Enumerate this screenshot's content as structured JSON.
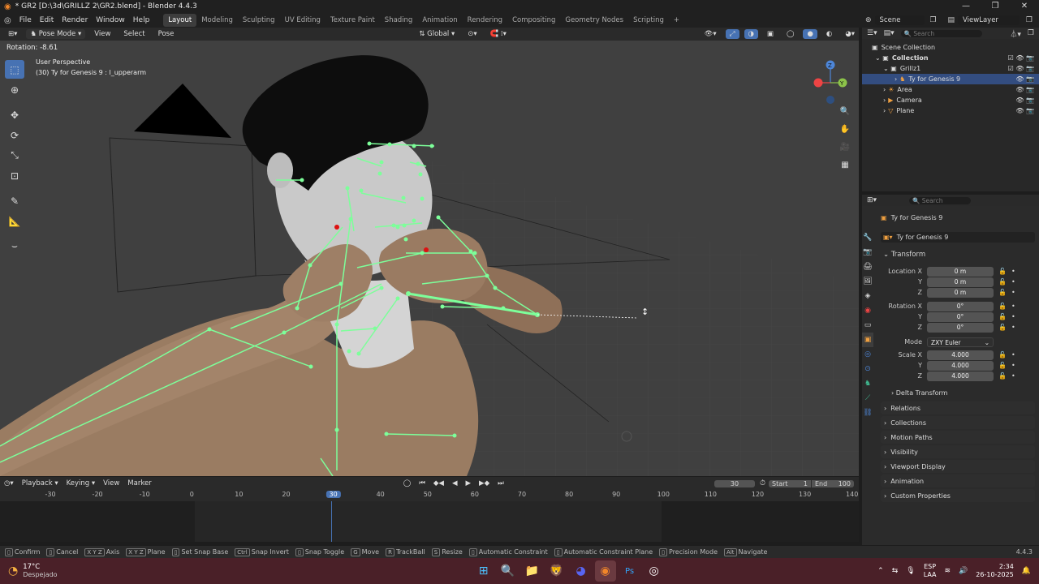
{
  "window": {
    "title": "* GR2 [D:\\3d\\GRILLZ 2\\GR2.blend] - Blender 4.4.3",
    "controls": [
      "—",
      "❐",
      "✕"
    ]
  },
  "menu": [
    "File",
    "Edit",
    "Render",
    "Window",
    "Help"
  ],
  "workspaces": [
    "Layout",
    "Modeling",
    "Sculpting",
    "UV Editing",
    "Texture Paint",
    "Shading",
    "Animation",
    "Rendering",
    "Compositing",
    "Geometry Nodes",
    "Scripting",
    "+"
  ],
  "workspace_active": "Layout",
  "scene": {
    "name": "Scene",
    "view_layer": "ViewLayer"
  },
  "viewport": {
    "mode": "Pose Mode",
    "menus": [
      "View",
      "Select",
      "Pose"
    ],
    "orientation": "Global",
    "status_line": "Rotation: -8.61",
    "perspective": "User Perspective",
    "frame_info": "(30) Ty for Genesis 9 : l_upperarm",
    "gizmo_axes": [
      "Z",
      "Y",
      "X"
    ]
  },
  "outliner": {
    "search_placeholder": "Search",
    "rows": [
      {
        "label": "Scene Collection",
        "indent": 0
      },
      {
        "label": "Collection",
        "indent": 1
      },
      {
        "label": "Grillz1",
        "indent": 2
      },
      {
        "label": "Ty for Genesis 9",
        "indent": 3,
        "selected": true
      },
      {
        "label": "Area",
        "indent": 2
      },
      {
        "label": "Camera",
        "indent": 2
      },
      {
        "label": "Plane",
        "indent": 2
      }
    ]
  },
  "properties": {
    "search_placeholder": "Search",
    "object_path": "Ty for Genesis 9",
    "object_name": "Ty for Genesis 9",
    "transform_label": "Transform",
    "location": {
      "label": "Location X",
      "x": "0 m",
      "y": "0 m",
      "z": "0 m"
    },
    "rotation": {
      "label": "Rotation X",
      "x": "0°",
      "y": "0°",
      "z": "0°"
    },
    "mode": {
      "label": "Mode",
      "value": "ZXY Euler"
    },
    "scale": {
      "label": "Scale X",
      "x": "4.000",
      "y": "4.000",
      "z": "4.000"
    },
    "axis_y": "Y",
    "axis_z": "Z",
    "delta_transform": "Delta Transform",
    "panels": [
      "Relations",
      "Collections",
      "Motion Paths",
      "Visibility",
      "Viewport Display",
      "Animation",
      "Custom Properties"
    ]
  },
  "timeline": {
    "menus": [
      "Playback",
      "Keying",
      "View",
      "Marker"
    ],
    "current_frame": "30",
    "start_label": "Start",
    "start": "1",
    "end_label": "End",
    "end": "100",
    "ticks": [
      "-30",
      "-20",
      "-10",
      "0",
      "10",
      "20",
      "30",
      "40",
      "50",
      "60",
      "70",
      "80",
      "90",
      "100",
      "110",
      "120",
      "130",
      "140"
    ]
  },
  "statusbar": {
    "items": [
      {
        "key": "",
        "label": "Confirm"
      },
      {
        "key": "",
        "label": "Cancel"
      },
      {
        "key": "X Y Z",
        "label": "Axis"
      },
      {
        "key": "X Y Z",
        "label": "Plane"
      },
      {
        "key": "",
        "label": "Set Snap Base"
      },
      {
        "key": "Ctrl",
        "label": "Snap Invert"
      },
      {
        "key": "",
        "label": "Snap Toggle"
      },
      {
        "key": "G",
        "label": "Move"
      },
      {
        "key": "R",
        "label": "TrackBall"
      },
      {
        "key": "S",
        "label": "Resize"
      },
      {
        "key": "",
        "label": "Automatic Constraint"
      },
      {
        "key": "",
        "label": "Automatic Constraint Plane"
      },
      {
        "key": "",
        "label": "Precision Mode"
      },
      {
        "key": "Alt",
        "label": "Navigate"
      }
    ],
    "version": "4.4.3"
  },
  "taskbar": {
    "weather_temp": "17°C",
    "weather_desc": "Despejado",
    "lang": "ESP",
    "lang_sub": "LAA",
    "time": "2:34",
    "date": "26-10-2025"
  },
  "colors": {
    "accent": "#4772b3",
    "bone": "#7dff9a",
    "viewport_bg": "#3f3f3f",
    "taskbar": "#4a2028"
  }
}
